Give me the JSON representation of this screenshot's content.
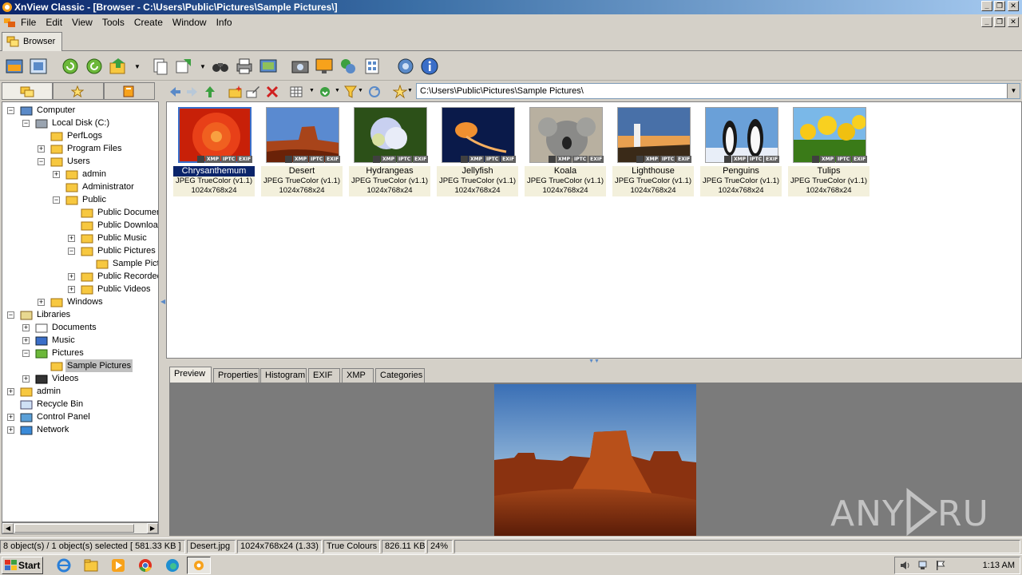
{
  "window": {
    "title": "XnView Classic - [Browser - C:\\Users\\Public\\Pictures\\Sample Pictures\\]"
  },
  "menu": [
    "File",
    "Edit",
    "View",
    "Tools",
    "Create",
    "Window",
    "Info"
  ],
  "tab": {
    "label": "Browser"
  },
  "address": {
    "path": "C:\\Users\\Public\\Pictures\\Sample Pictures\\"
  },
  "tree": [
    {
      "label": "Computer",
      "icon": "computer-icon",
      "expander": "minus"
    },
    {
      "label": "Local Disk (C:)",
      "icon": "drive-icon",
      "expander": "minus"
    },
    {
      "label": "PerfLogs",
      "icon": "folder-icon",
      "expander": ""
    },
    {
      "label": "Program Files",
      "icon": "folder-icon",
      "expander": "plus"
    },
    {
      "label": "Users",
      "icon": "folder-icon",
      "expander": "minus"
    },
    {
      "label": "admin",
      "icon": "folder-icon",
      "expander": "plus"
    },
    {
      "label": "Administrator",
      "icon": "folder-icon",
      "expander": ""
    },
    {
      "label": "Public",
      "icon": "folder-icon",
      "expander": "minus"
    },
    {
      "label": "Public Documen",
      "icon": "folder-icon",
      "expander": ""
    },
    {
      "label": "Public Downloac",
      "icon": "folder-icon",
      "expander": ""
    },
    {
      "label": "Public Music",
      "icon": "folder-icon",
      "expander": "plus"
    },
    {
      "label": "Public Pictures",
      "icon": "folder-icon",
      "expander": "minus"
    },
    {
      "label": "Sample Pictu",
      "icon": "folder-icon",
      "expander": ""
    },
    {
      "label": "Public Recorded",
      "icon": "folder-icon",
      "expander": "plus"
    },
    {
      "label": "Public Videos",
      "icon": "folder-icon",
      "expander": "plus"
    },
    {
      "label": "Windows",
      "icon": "folder-icon",
      "expander": "plus"
    },
    {
      "label": "Libraries",
      "icon": "libraries-icon",
      "expander": "minus"
    },
    {
      "label": "Documents",
      "icon": "documents-icon",
      "expander": "plus"
    },
    {
      "label": "Music",
      "icon": "music-icon",
      "expander": "plus"
    },
    {
      "label": "Pictures",
      "icon": "pictures-icon",
      "expander": "minus"
    },
    {
      "label": "Sample Pictures",
      "icon": "folder-icon",
      "expander": "",
      "selected": true
    },
    {
      "label": "Videos",
      "icon": "videos-icon",
      "expander": "plus"
    },
    {
      "label": "admin",
      "icon": "user-folder-icon",
      "expander": "plus"
    },
    {
      "label": "Recycle Bin",
      "icon": "recycle-bin-icon",
      "expander": ""
    },
    {
      "label": "Control Panel",
      "icon": "control-panel-icon",
      "expander": "plus"
    },
    {
      "label": "Network",
      "icon": "network-icon",
      "expander": "plus"
    }
  ],
  "thumbnails": [
    {
      "name": "Chrysanthemum",
      "format": "JPEG TrueColor (v1.1)",
      "size": "1024x768x24",
      "selected": true
    },
    {
      "name": "Desert",
      "format": "JPEG TrueColor (v1.1)",
      "size": "1024x768x24"
    },
    {
      "name": "Hydrangeas",
      "format": "JPEG TrueColor (v1.1)",
      "size": "1024x768x24"
    },
    {
      "name": "Jellyfish",
      "format": "JPEG TrueColor (v1.1)",
      "size": "1024x768x24"
    },
    {
      "name": "Koala",
      "format": "JPEG TrueColor (v1.1)",
      "size": "1024x768x24"
    },
    {
      "name": "Lighthouse",
      "format": "JPEG TrueColor (v1.1)",
      "size": "1024x768x24"
    },
    {
      "name": "Penguins",
      "format": "JPEG TrueColor (v1.1)",
      "size": "1024x768x24"
    },
    {
      "name": "Tulips",
      "format": "JPEG TrueColor (v1.1)",
      "size": "1024x768x24"
    }
  ],
  "badges": [
    "XMP",
    "IPTC",
    "EXIF"
  ],
  "preview_tabs": [
    "Preview",
    "Properties",
    "Histogram",
    "EXIF",
    "XMP",
    "Categories"
  ],
  "status": {
    "selection": "8 object(s) / 1 object(s) selected  [ 581.33 KB ]",
    "filename": "Desert.jpg",
    "dimensions": "1024x768x24 (1.33)",
    "colors": "True Colours",
    "filesize": "826.11 KB",
    "zoom": "24%"
  },
  "taskbar": {
    "start": "Start",
    "clock": "1:13 AM"
  },
  "watermark": "ANY RUN"
}
